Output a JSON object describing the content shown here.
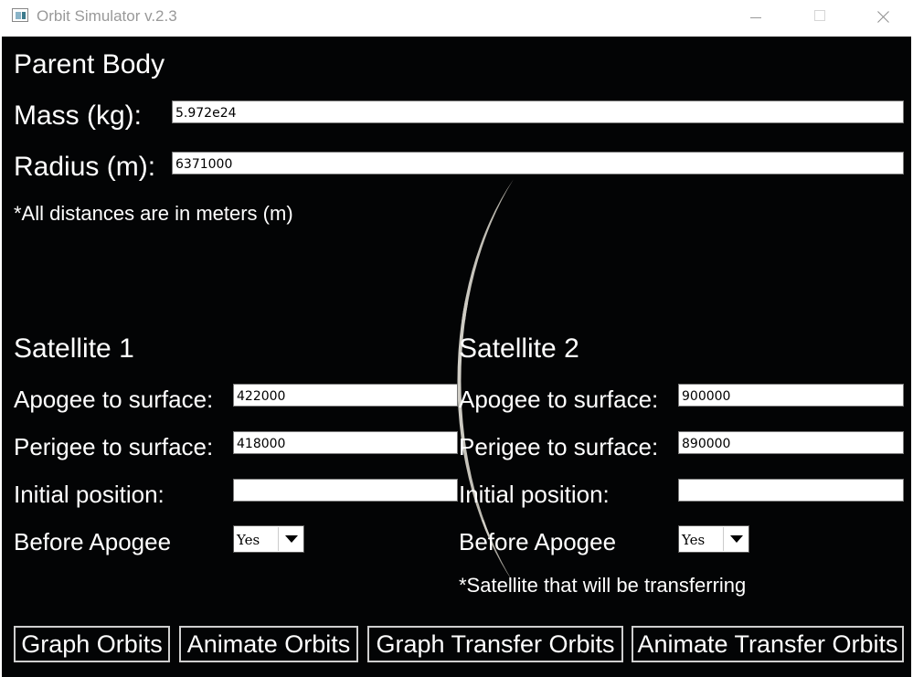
{
  "window": {
    "title": "Orbit Simulator v.2.3"
  },
  "parent_body": {
    "heading": "Parent Body",
    "mass_label": "Mass (kg):",
    "mass_value": "5.972e24",
    "radius_label": "Radius (m):",
    "radius_value": "6371000",
    "note": "*All distances are in meters (m)"
  },
  "satellite1": {
    "heading": "Satellite 1",
    "apogee_label": "Apogee to surface:",
    "apogee_value": "422000",
    "perigee_label": "Perigee to surface:",
    "perigee_value": "418000",
    "position_label": "Initial position:",
    "position_value": "",
    "before_apogee_label": "Before Apogee",
    "before_apogee_value": "Yes"
  },
  "satellite2": {
    "heading": "Satellite 2",
    "apogee_label": "Apogee to surface:",
    "apogee_value": "900000",
    "perigee_label": "Perigee to surface:",
    "perigee_value": "890000",
    "position_label": "Initial position:",
    "position_value": "",
    "before_apogee_label": "Before Apogee",
    "before_apogee_value": "Yes",
    "note": "*Satellite that will be transferring"
  },
  "buttons": {
    "graph_orbits": "Graph Orbits",
    "animate_orbits": "Animate Orbits",
    "graph_transfer": "Graph Transfer Orbits",
    "animate_transfer": "Animate Transfer Orbits"
  },
  "colors": {
    "background": "#030405",
    "text": "#ffffff",
    "field": "#ffffff"
  }
}
